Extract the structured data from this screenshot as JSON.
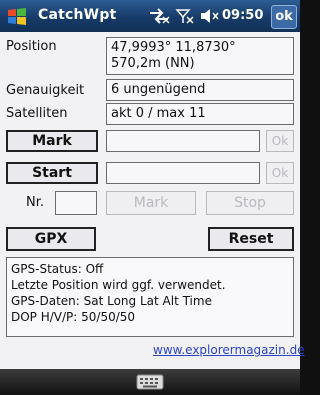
{
  "titlebar": {
    "title": "CatchWpt",
    "time": "09:50",
    "ok_label": "ok"
  },
  "fields": {
    "position_label": "Position",
    "position_line1": "47,9993°  11,8730°",
    "position_line2": "570,2m (NN)",
    "accuracy_label": "Genauigkeit",
    "accuracy_value": "6 ungenügend",
    "satellites_label": "Satelliten",
    "satellites_value": "akt 0 / max 11"
  },
  "mark_row": {
    "mark_label": "Mark",
    "ok_label": "Ok"
  },
  "start_row": {
    "start_label": "Start",
    "ok_label": "Ok"
  },
  "nr_row": {
    "nr_label": "Nr.",
    "mark_label": "Mark",
    "stop_label": "Stop"
  },
  "actions": {
    "gpx_label": "GPX",
    "reset_label": "Reset"
  },
  "status": {
    "line1": "GPS-Status: Off",
    "line2": "Letzte Position wird ggf. verwendet.",
    "line3": "GPS-Daten:  Sat  Long Lat Alt Time",
    "line4": "DOP H/V/P: 50/50/50"
  },
  "footer": {
    "link_text": "www.explorermagazin.de"
  },
  "icons": {
    "start": "windows-flag-icon",
    "connectivity": "connectivity-icon",
    "signal": "signal-icon",
    "volume": "volume-icon",
    "keyboard": "keyboard-icon"
  },
  "colors": {
    "titlebar": "#1c467b",
    "link": "#2b43c9",
    "background": "#f2f2f4"
  }
}
